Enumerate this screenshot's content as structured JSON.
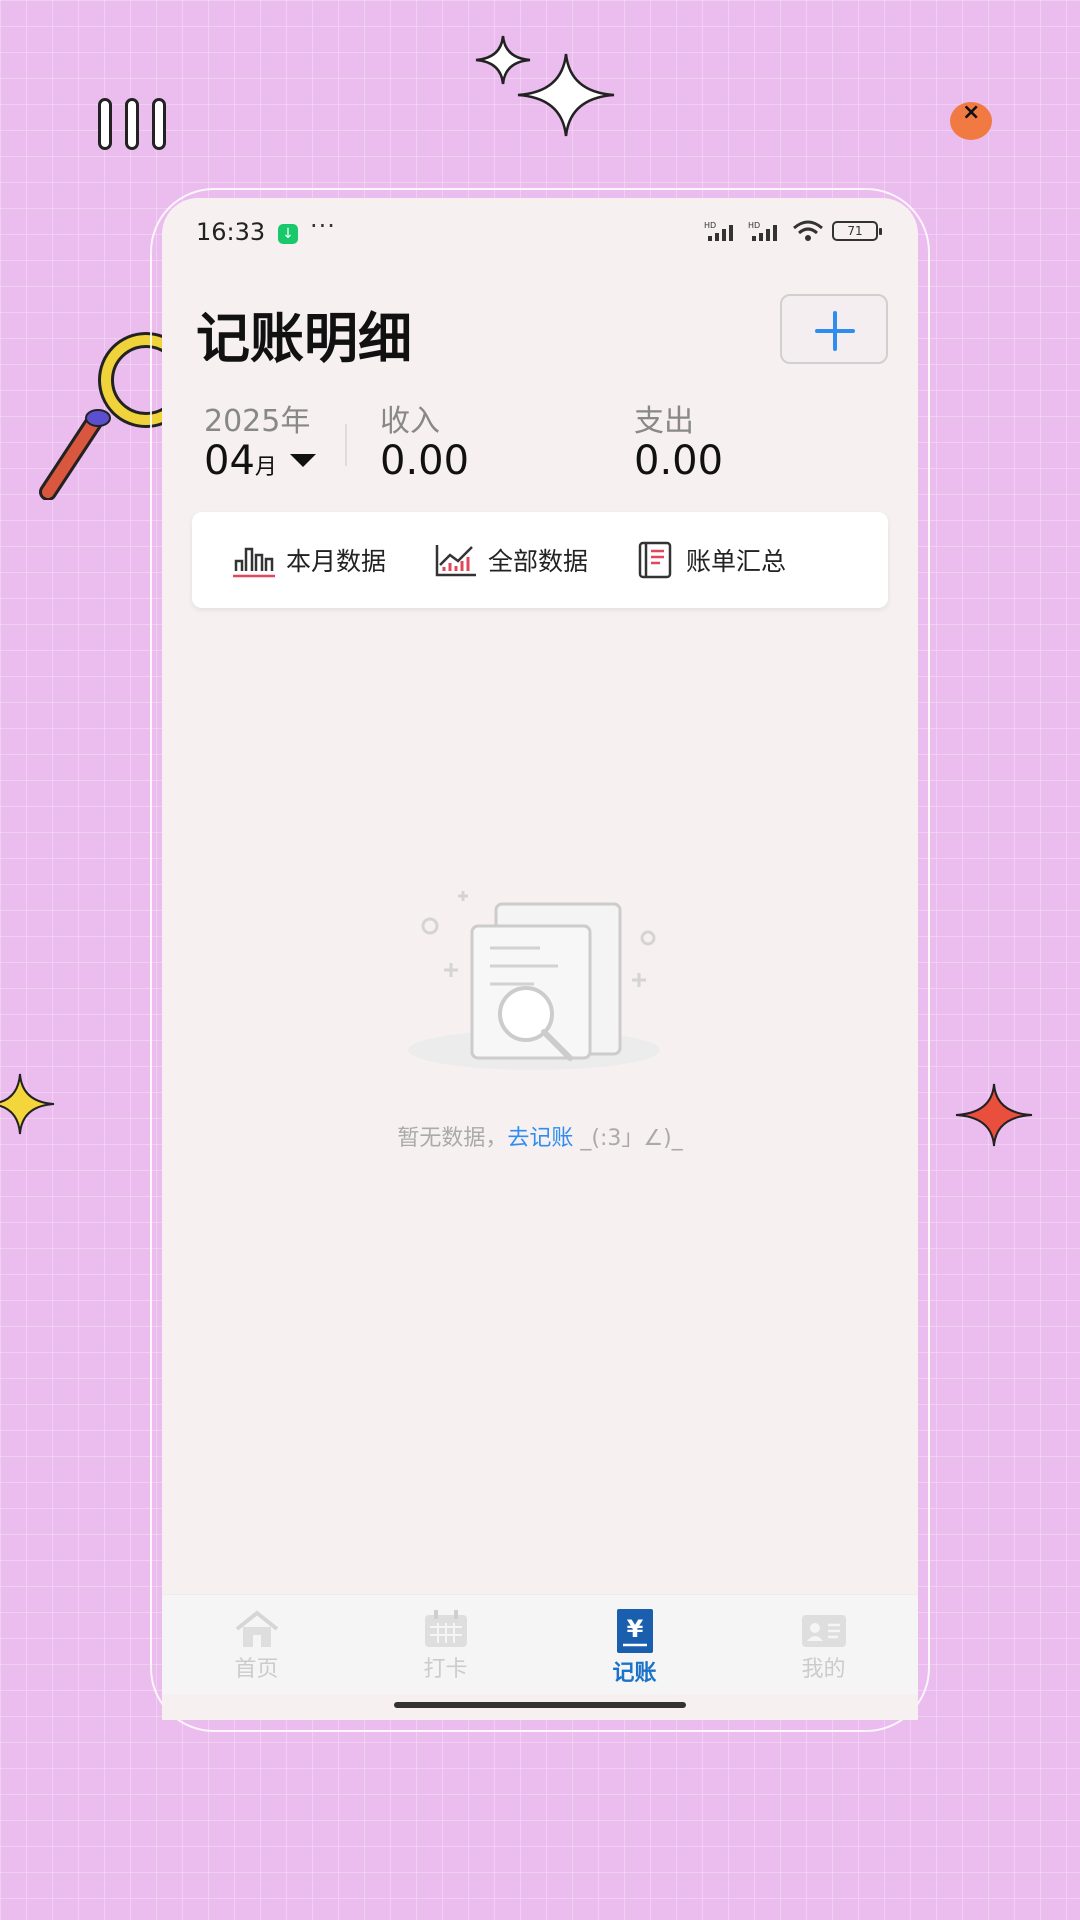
{
  "status_bar": {
    "time": "16:33",
    "more": "···",
    "battery": "71"
  },
  "header": {
    "title": "记账明细"
  },
  "summary": {
    "year": "2025年",
    "month": "04",
    "month_suffix": "月",
    "income_label": "收入",
    "income_value": "0.00",
    "expense_label": "支出",
    "expense_value": "0.00"
  },
  "tabs": [
    {
      "label": "本月数据",
      "icon": "bar-chart-icon"
    },
    {
      "label": "全部数据",
      "icon": "trend-chart-icon"
    },
    {
      "label": "账单汇总",
      "icon": "bill-list-icon"
    }
  ],
  "empty_state": {
    "text": "暂无数据，",
    "link": "去记账",
    "emoticon": "_(:3」∠)_"
  },
  "bottom_nav": [
    {
      "label": "首页",
      "icon": "home-icon",
      "active": false
    },
    {
      "label": "打卡",
      "icon": "calendar-icon",
      "active": false
    },
    {
      "label": "记账",
      "icon": "yen-icon",
      "active": true
    },
    {
      "label": "我的",
      "icon": "profile-card-icon",
      "active": false
    }
  ],
  "colors": {
    "accent": "#2f8df0",
    "active_nav": "#1a73c8",
    "background": "#ebbcee"
  }
}
